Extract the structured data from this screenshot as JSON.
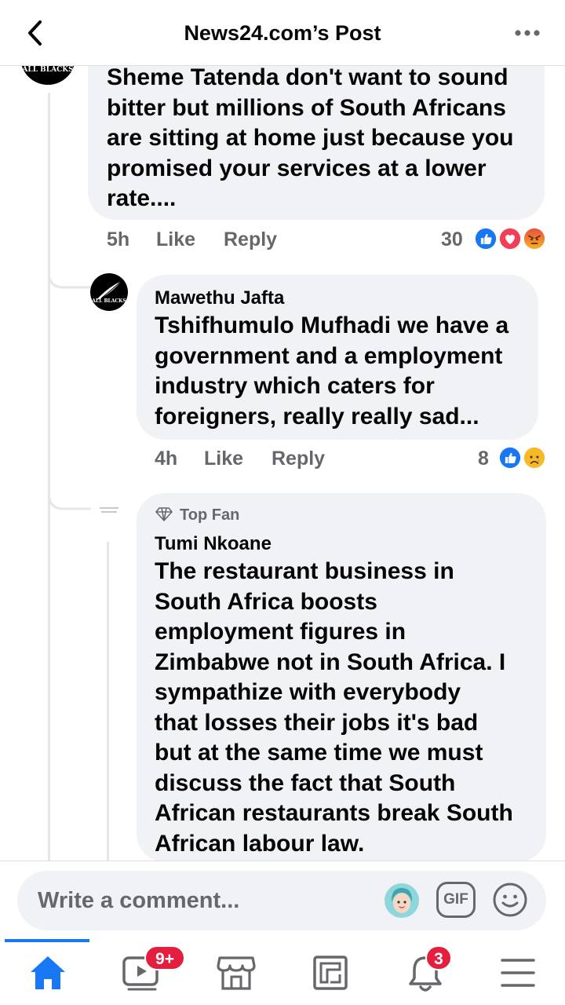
{
  "header": {
    "title": "News24.com’s Post"
  },
  "comments": [
    {
      "avatar_text": "ALL BLACKS",
      "text": "Sheme Tatenda don't want to sound bitter but millions of South Africans are sitting at home just because you promised your services at a lower rate....",
      "lines": [
        "Sheme Tatenda don't want to sound",
        "bitter but millions of South Africans",
        "are sitting at home just because you",
        "promised your services at a lower",
        "rate...."
      ],
      "time": "5h",
      "like_label": "Like",
      "reply_label": "Reply",
      "reaction_count": "30",
      "reactions": [
        "like",
        "love",
        "angry"
      ]
    },
    {
      "author": "Mawethu Jafta",
      "avatar_text": "ALL BLACKS",
      "lines": [
        "Tshifhumulo Mufhadi we have a",
        "government and a employment",
        "industry which caters for",
        "foreigners, really really sad..."
      ],
      "time": "4h",
      "like_label": "Like",
      "reply_label": "Reply",
      "reaction_count": "8",
      "reactions": [
        "like",
        "sad"
      ]
    },
    {
      "badge": "Top Fan",
      "author": "Tumi Nkoane",
      "lines": [
        "The restaurant business in",
        "South Africa boosts",
        "employment figures in",
        "Zimbabwe not in South Africa. I",
        "sympathize with everybody",
        "that losses their jobs it's bad",
        "but at the same time we must",
        "discuss the fact that South",
        "African restaurants break South",
        "African labour law."
      ]
    }
  ],
  "composer": {
    "placeholder": "Write a comment...",
    "gif_label": "GIF"
  },
  "bottom_nav": {
    "items": [
      "home-icon",
      "watch-icon",
      "marketplace-icon",
      "news-feed-icon",
      "notifications-icon",
      "menu-icon"
    ],
    "watch_badge": "9+",
    "notifications_badge": "3",
    "active_color": "#1877f2"
  },
  "colors": {
    "bubble": "#f0f2f5",
    "secondary_text": "#65676b",
    "like_blue": "#1877f2",
    "love_red": "#f33e58",
    "badge_red": "#e41e3f"
  }
}
